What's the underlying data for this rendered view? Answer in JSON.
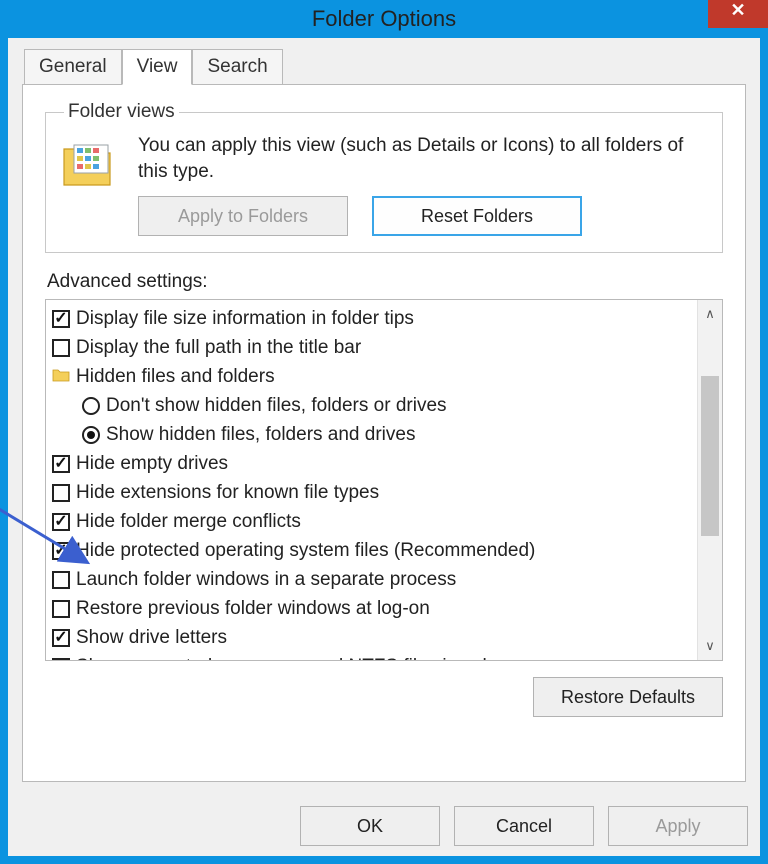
{
  "window": {
    "title": "Folder Options",
    "close_glyph": "✕"
  },
  "tabs": {
    "general": "General",
    "view": "View",
    "search": "Search"
  },
  "folder_views": {
    "legend": "Folder views",
    "text": "You can apply this view (such as Details or Icons) to all folders of this type.",
    "apply_label": "Apply to Folders",
    "reset_label": "Reset Folders"
  },
  "advanced": {
    "label": "Advanced settings:",
    "items": [
      {
        "type": "checkbox",
        "checked": true,
        "indent": 0,
        "label": "Display file size information in folder tips"
      },
      {
        "type": "checkbox",
        "checked": false,
        "indent": 0,
        "label": "Display the full path in the title bar"
      },
      {
        "type": "folder",
        "indent": 0,
        "label": "Hidden files and folders"
      },
      {
        "type": "radio",
        "selected": false,
        "indent": 1,
        "label": "Don't show hidden files, folders or drives"
      },
      {
        "type": "radio",
        "selected": true,
        "indent": 1,
        "label": "Show hidden files, folders and drives"
      },
      {
        "type": "checkbox",
        "checked": true,
        "indent": 0,
        "label": "Hide empty drives"
      },
      {
        "type": "checkbox",
        "checked": false,
        "indent": 0,
        "label": "Hide extensions for known file types"
      },
      {
        "type": "checkbox",
        "checked": true,
        "indent": 0,
        "label": "Hide folder merge conflicts"
      },
      {
        "type": "checkbox",
        "checked": true,
        "indent": 0,
        "label": "Hide protected operating system files (Recommended)"
      },
      {
        "type": "checkbox",
        "checked": false,
        "indent": 0,
        "label": "Launch folder windows in a separate process"
      },
      {
        "type": "checkbox",
        "checked": false,
        "indent": 0,
        "label": "Restore previous folder windows at log-on"
      },
      {
        "type": "checkbox",
        "checked": true,
        "indent": 0,
        "label": "Show drive letters"
      },
      {
        "type": "checkbox",
        "checked": true,
        "indent": 0,
        "label": "Show encrypted or compressed NTFS files in colour"
      }
    ],
    "restore_label": "Restore Defaults"
  },
  "buttons": {
    "ok": "OK",
    "cancel": "Cancel",
    "apply": "Apply"
  }
}
